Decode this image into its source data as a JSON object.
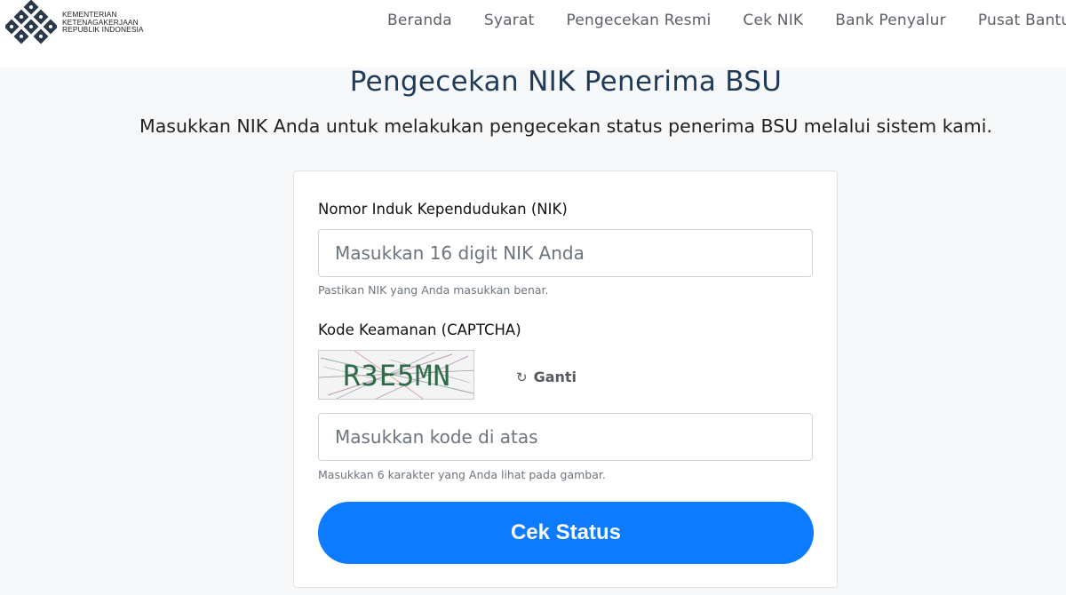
{
  "header": {
    "logo_icon": "kemnaker-logo-icon",
    "logo_lines": [
      "KEMENTERIAN",
      "KETENAGAKERJAAN",
      "REPUBLIK INDONESIA"
    ],
    "nav": [
      {
        "label": "Beranda"
      },
      {
        "label": "Syarat"
      },
      {
        "label": "Pengecekan Resmi"
      },
      {
        "label": "Cek NIK"
      },
      {
        "label": "Bank Penyalur"
      },
      {
        "label": "Pusat Bantuan"
      }
    ]
  },
  "hero": {
    "title": "Pengecekan NIK Penerima BSU",
    "subtitle": "Masukkan NIK Anda untuk melakukan pengecekan status penerima BSU melalui sistem kami."
  },
  "form": {
    "nik": {
      "label": "Nomor Induk Kependudukan (NIK)",
      "placeholder": "Masukkan 16 digit NIK Anda",
      "value": "",
      "help": "Pastikan NIK yang Anda masukkan benar."
    },
    "captcha": {
      "label": "Kode Keamanan (CAPTCHA)",
      "code": "R3E5MN",
      "refresh_icon": "refresh-icon",
      "refresh_label": "Ganti",
      "placeholder": "Masukkan kode di atas",
      "value": "",
      "help": "Masukkan 6 karakter yang Anda lihat pada gambar."
    },
    "submit_label": "Cek Status"
  },
  "colors": {
    "primary": "#0d7bff",
    "title": "#1f3b58",
    "background": "#f7f8fa"
  }
}
